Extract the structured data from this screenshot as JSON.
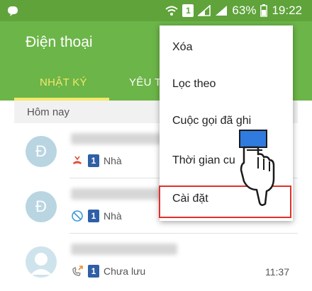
{
  "status_bar": {
    "battery_percent": "63%",
    "time": "19:22",
    "sim_label": "1"
  },
  "app": {
    "title": "Điện thoại",
    "tabs": [
      {
        "label": "NHẬT KÝ"
      },
      {
        "label": "YÊU T"
      }
    ]
  },
  "section": {
    "label": "Hôm nay"
  },
  "calls": [
    {
      "avatar_letter": "Đ",
      "sim": "1",
      "label": "Nhà",
      "time": ""
    },
    {
      "avatar_letter": "Đ",
      "sim": "1",
      "label": "Nhà",
      "time": ""
    },
    {
      "avatar_letter": "",
      "sim": "1",
      "label": "Chưa lưu",
      "time": "11:37"
    }
  ],
  "menu": {
    "items": [
      {
        "label": "Xóa"
      },
      {
        "label": "Lọc theo"
      },
      {
        "label": "Cuộc gọi đã ghi"
      },
      {
        "label": "Thời gian cu"
      },
      {
        "label": "Cài đặt"
      }
    ]
  },
  "colors": {
    "app_bar": "#6cb548",
    "status_bar": "#5fa33a",
    "tab_active": "#f4e86a",
    "highlight": "#e0302a",
    "sim_badge": "#2f5fa6"
  }
}
